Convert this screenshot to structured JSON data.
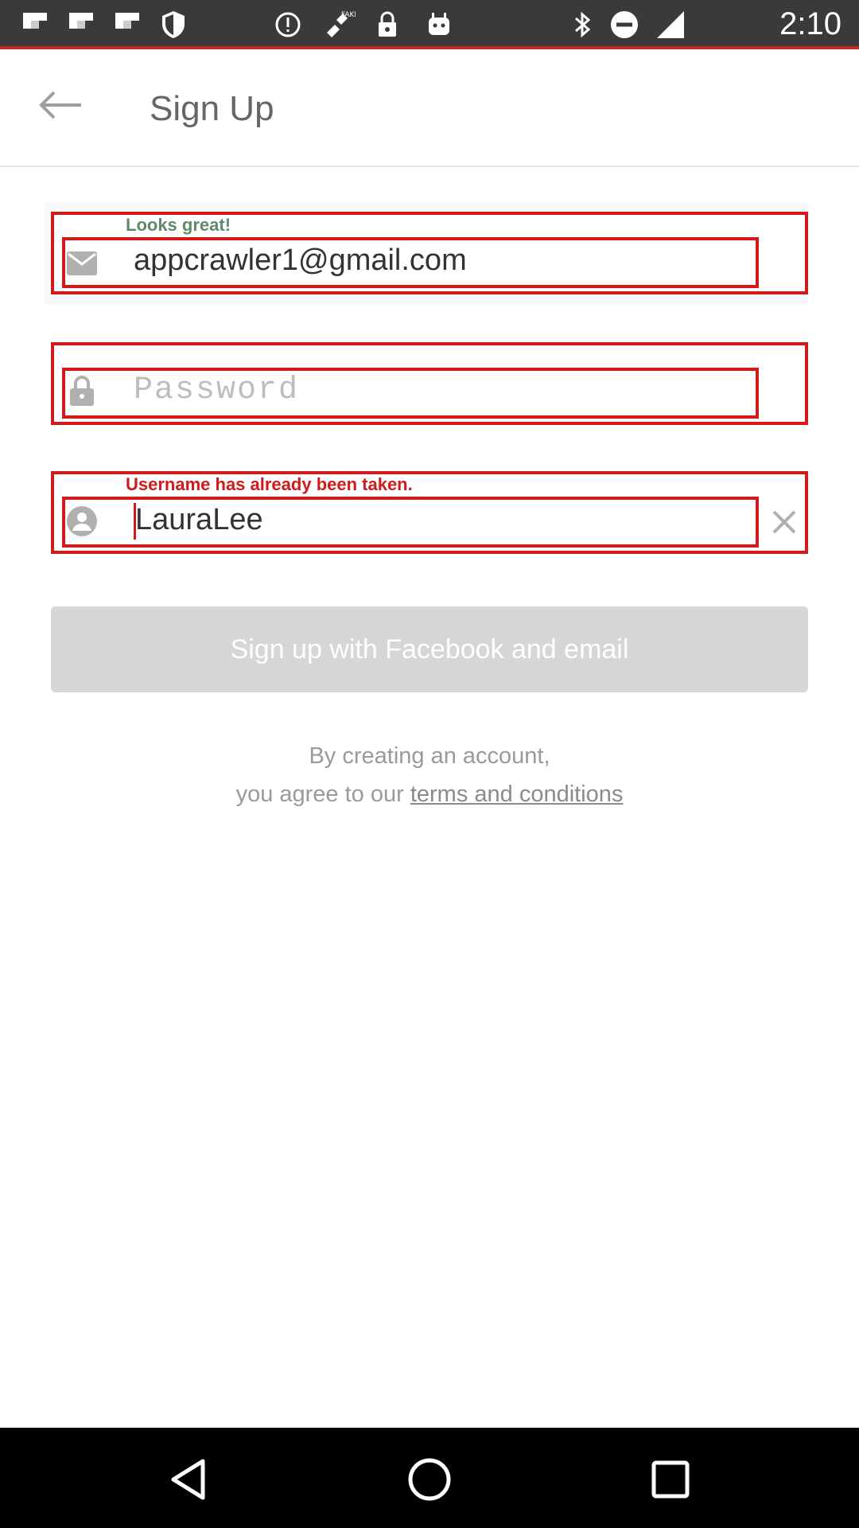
{
  "status_bar": {
    "time": "2:10",
    "left_icons": [
      "flipboard-icon",
      "flipboard-icon",
      "flipboard-icon",
      "shield-icon",
      "info-circle-icon",
      "fake-gps-icon",
      "lock-icon",
      "android-icon"
    ],
    "right_icons": [
      "bluetooth-icon",
      "do-not-disturb-icon",
      "signal-icon"
    ]
  },
  "toolbar": {
    "title": "Sign Up",
    "back_icon": "arrow-left-icon"
  },
  "form": {
    "email": {
      "hint": "Looks great!",
      "value": "appcrawler1@gmail.com",
      "icon": "mail-icon"
    },
    "password": {
      "placeholder": "Password",
      "icon": "lock-icon"
    },
    "username": {
      "hint": "Username has already been taken.",
      "value": "LauraLee",
      "icon": "user-icon",
      "clear_icon": "close-icon"
    }
  },
  "signup_button": {
    "label": "Sign up with Facebook and email"
  },
  "terms": {
    "line1": "By creating an account,",
    "line2_prefix": "you agree to our ",
    "link": "terms and conditions"
  },
  "colors": {
    "status_bar": "#3a3a3a",
    "accent_red": "#d11a1a",
    "hint_green": "#5f8a6a",
    "button_disabled": "#d6d6d6"
  },
  "nav_bar": {
    "icons": [
      "back-triangle-icon",
      "home-circle-icon",
      "recents-square-icon"
    ]
  }
}
